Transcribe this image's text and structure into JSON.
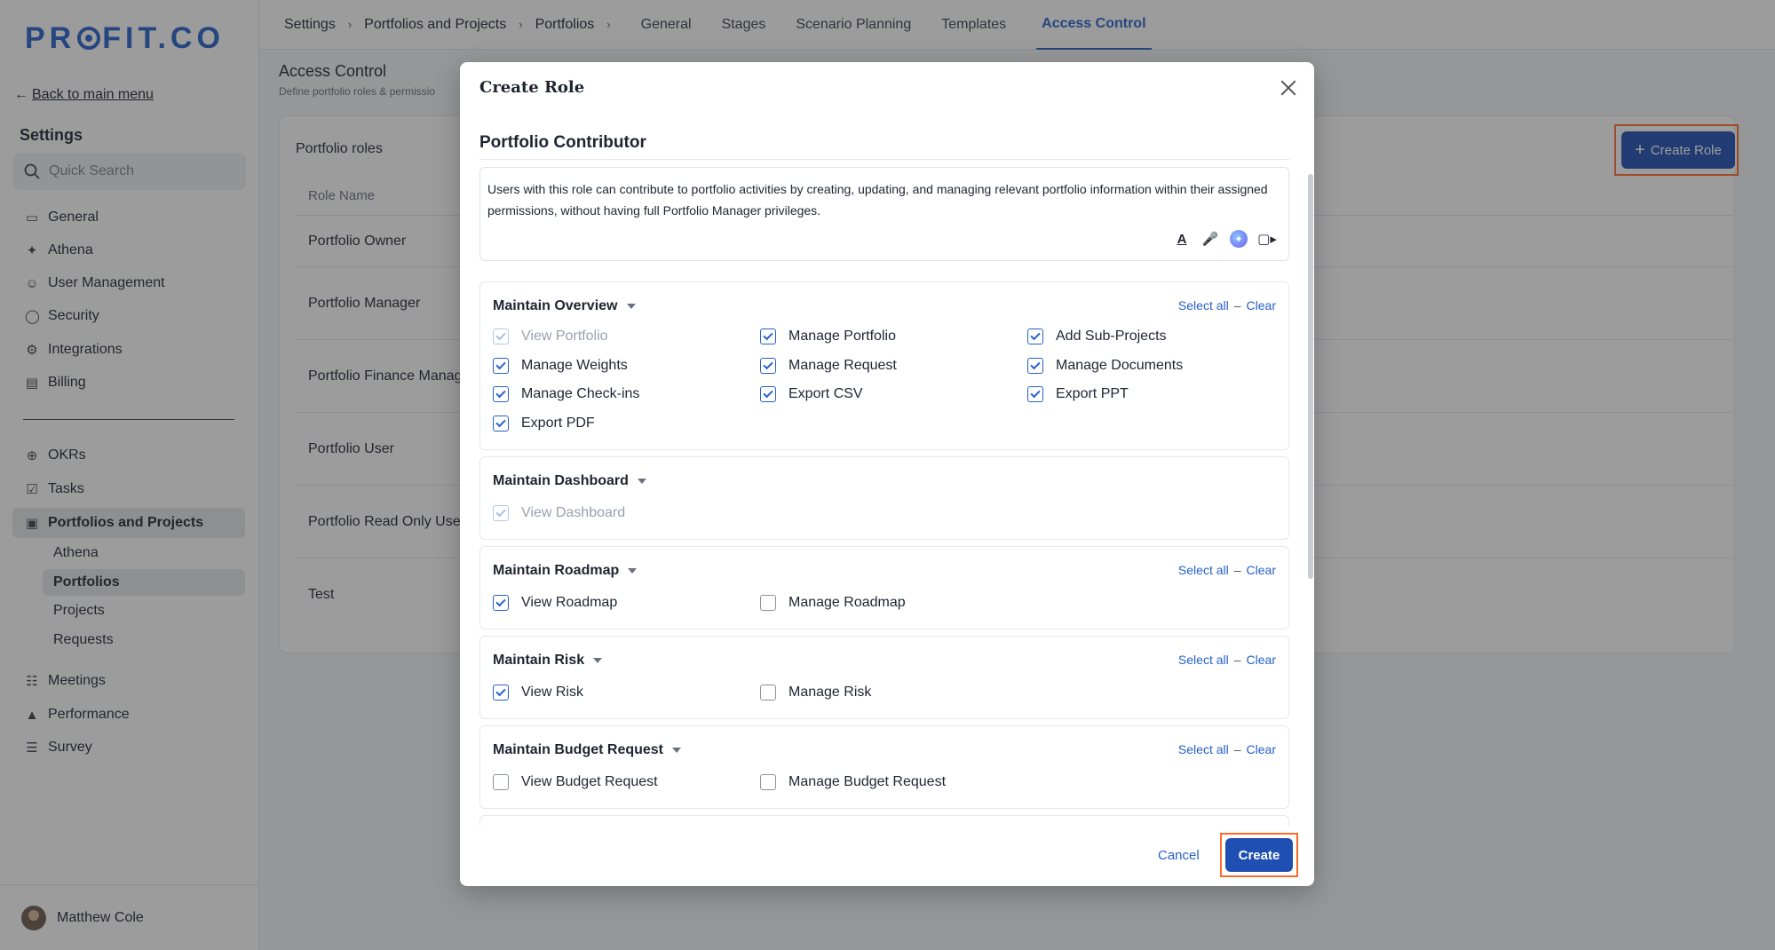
{
  "app": {
    "logo": "PR",
    "logo_rest": "FIT.CO",
    "back_label": "Back to main menu",
    "settings_title": "Settings",
    "search_placeholder": "Quick Search",
    "nav_top": [
      "General",
      "Athena",
      "User Management",
      "Security",
      "Integrations",
      "Billing"
    ],
    "nav_bottom": [
      "OKRs",
      "Tasks",
      "Portfolios and Projects"
    ],
    "sub_nav": [
      "Athena",
      "Portfolios",
      "Projects",
      "Requests"
    ],
    "nav_more": [
      "Meetings",
      "Performance",
      "Survey"
    ],
    "user_name": "Matthew Cole"
  },
  "topbar": {
    "breadcrumbs": [
      "Settings",
      "Portfolios and Projects",
      "Portfolios"
    ],
    "tabs": [
      "General",
      "Stages",
      "Scenario Planning",
      "Templates",
      "Access Control"
    ]
  },
  "page": {
    "title": "Access Control",
    "subtitle": "Define portfolio roles & permissio",
    "card_title": "Portfolio roles",
    "create_role_label": "Create Role",
    "table_header": "Role Name",
    "roles": [
      "Portfolio Owner",
      "Portfolio Manager",
      "Portfolio Finance Manag",
      "Portfolio User",
      "Portfolio Read Only Use",
      "Test"
    ]
  },
  "modal": {
    "title": "Create Role",
    "role_name_value": "Portfolio Contributor",
    "description": "Users with this role can contribute to portfolio activities by creating, updating, and managing relevant portfolio information within their assigned permissions, without having full Portfolio Manager privileges.",
    "select_all": "Select all",
    "clear": "Clear",
    "cancel_label": "Cancel",
    "create_label": "Create",
    "sections": [
      {
        "title": "Maintain Overview",
        "perms": [
          {
            "label": "View Portfolio",
            "state": "disabled-checked"
          },
          {
            "label": "Manage Portfolio",
            "state": "checked"
          },
          {
            "label": "Add Sub-Projects",
            "state": "checked"
          },
          {
            "label": "Manage Weights",
            "state": "checked"
          },
          {
            "label": "Manage Request",
            "state": "checked"
          },
          {
            "label": "Manage Documents",
            "state": "checked"
          },
          {
            "label": "Manage Check-ins",
            "state": "checked"
          },
          {
            "label": "Export CSV",
            "state": "checked"
          },
          {
            "label": "Export PPT",
            "state": "checked"
          },
          {
            "label": "Export PDF",
            "state": "checked"
          }
        ]
      },
      {
        "title": "Maintain Dashboard",
        "perms": [
          {
            "label": "View Dashboard",
            "state": "disabled-checked"
          }
        ]
      },
      {
        "title": "Maintain Roadmap",
        "perms": [
          {
            "label": "View Roadmap",
            "state": "checked"
          },
          {
            "label": "Manage Roadmap",
            "state": "unchecked"
          }
        ]
      },
      {
        "title": "Maintain Risk",
        "perms": [
          {
            "label": "View Risk",
            "state": "checked"
          },
          {
            "label": "Manage Risk",
            "state": "unchecked"
          }
        ]
      },
      {
        "title": "Maintain Budget Request",
        "perms": [
          {
            "label": "View Budget Request",
            "state": "unchecked"
          },
          {
            "label": "Manage Budget Request",
            "state": "unchecked"
          }
        ]
      }
    ]
  },
  "icons": {
    "back": "arrow-left-icon",
    "search": "search-icon",
    "text_format": "text-format-icon",
    "mic": "microphone-icon",
    "ai": "ai-assistant-icon",
    "video": "video-icon",
    "plus": "plus-icon",
    "close": "close-icon"
  },
  "colors": {
    "accent": "#2560c9",
    "primary_button": "#1f4fb3",
    "highlight_outline": "#ff6a2b"
  }
}
